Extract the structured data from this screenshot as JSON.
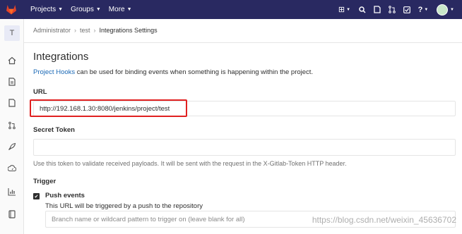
{
  "nav": {
    "projects": "Projects",
    "groups": "Groups",
    "more": "More"
  },
  "sidebar": {
    "project_letter": "T"
  },
  "breadcrumb": {
    "root": "Administrator",
    "project": "test",
    "current": "Integrations Settings"
  },
  "page": {
    "title": "Integrations",
    "desc_link": "Project Hooks",
    "desc_rest": " can be used for binding events when something is happening within the project."
  },
  "form": {
    "url_label": "URL",
    "url_value": "http://192.168.1.30:8080/jenkins/project/test",
    "secret_label": "Secret Token",
    "secret_help": "Use this token to validate received payloads. It will be sent with the request in the X-Gitlab-Token HTTP header.",
    "trigger_label": "Trigger",
    "push_label": "Push events",
    "push_help": "This URL will be triggered by a push to the repository",
    "branch_placeholder": "Branch name or wildcard pattern to trigger on (leave blank for all)"
  },
  "watermark": "https://blog.csdn.net/weixin_45636702",
  "colors": {
    "navbar": "#292961",
    "link": "#1b69b6",
    "highlight": "#e02020"
  }
}
